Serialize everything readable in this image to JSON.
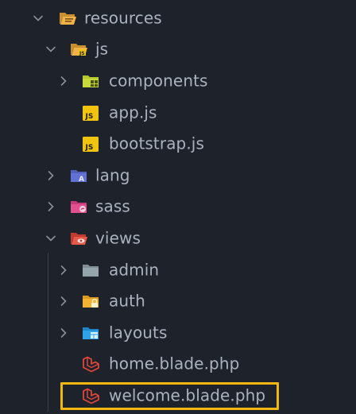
{
  "colors": {
    "background": "#1e222a",
    "text": "#abb2bf",
    "highlight_border": "#f1b70f",
    "folder_yellow": "#e8a93d",
    "js_badge": "#f1c40f",
    "laravel_red": "#e0463a"
  },
  "tree": {
    "resources": {
      "label": "resources",
      "icon": "folder-open-icon"
    },
    "js": {
      "label": "js",
      "icon": "folder-js-open-icon"
    },
    "components": {
      "label": "components",
      "icon": "folder-components-icon"
    },
    "app_js": {
      "label": "app.js",
      "icon": "js-file-icon"
    },
    "bootstrap_js": {
      "label": "bootstrap.js",
      "icon": "js-file-icon"
    },
    "lang": {
      "label": "lang",
      "icon": "folder-lang-icon"
    },
    "sass": {
      "label": "sass",
      "icon": "folder-sass-icon"
    },
    "views": {
      "label": "views",
      "icon": "folder-views-open-icon"
    },
    "admin": {
      "label": "admin",
      "icon": "folder-admin-icon"
    },
    "auth": {
      "label": "auth",
      "icon": "folder-auth-icon"
    },
    "layouts": {
      "label": "layouts",
      "icon": "folder-layouts-icon"
    },
    "home_blade": {
      "label": "home.blade.php",
      "icon": "laravel-icon"
    },
    "welcome_blade": {
      "label": "welcome.blade.php",
      "icon": "laravel-icon"
    }
  }
}
